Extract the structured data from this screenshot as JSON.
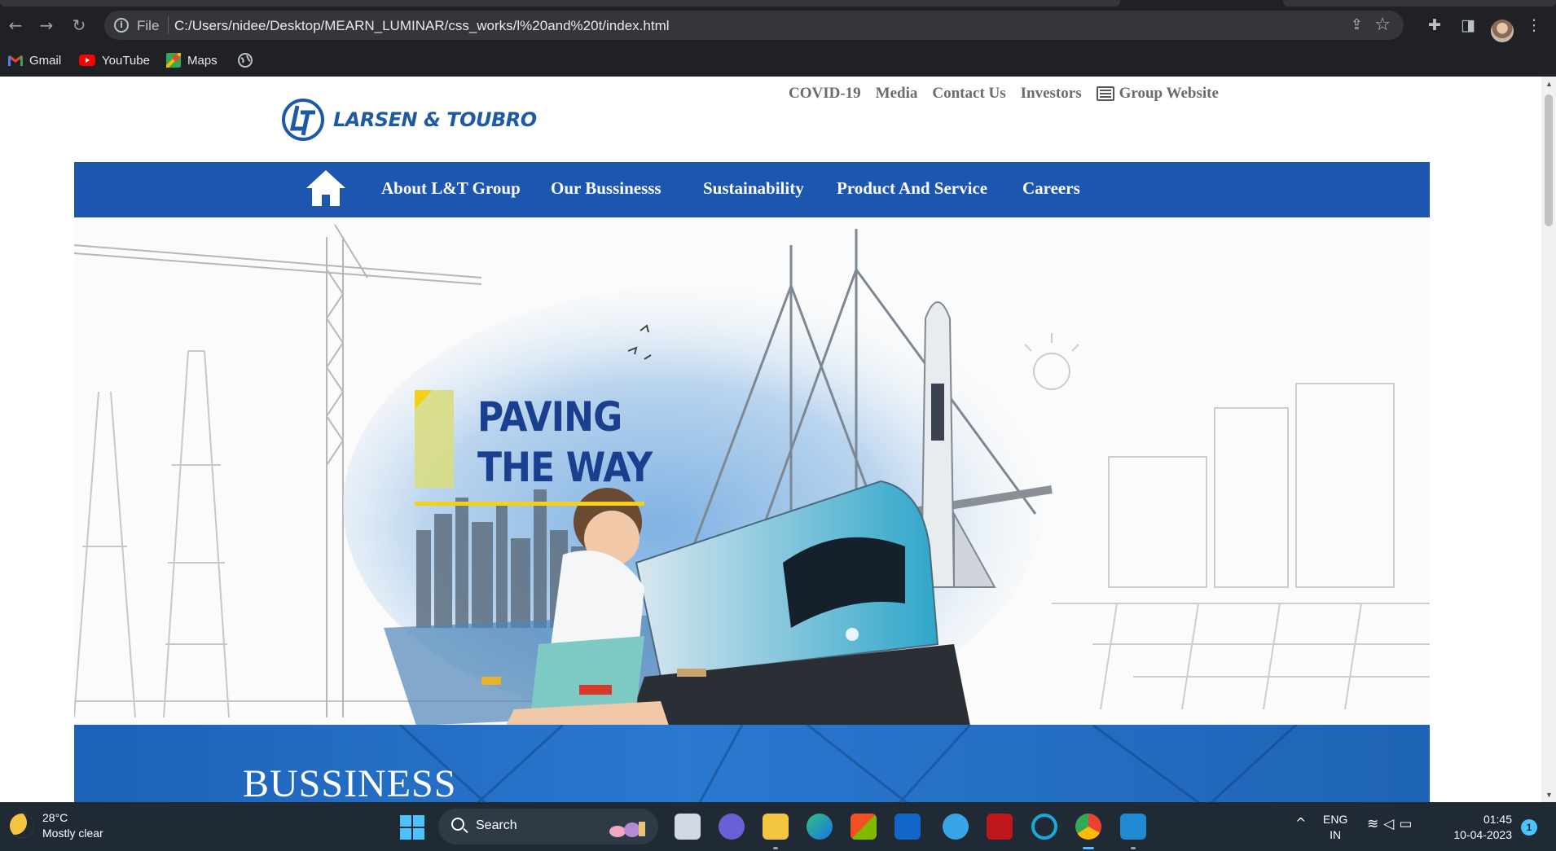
{
  "browser": {
    "url_scheme": "File",
    "url": "C:/Users/nidee/Desktop/MEARN_LUMINAR/css_works/l%20and%20t/index.html",
    "bookmarks": [
      "Gmail",
      "YouTube",
      "Maps"
    ]
  },
  "site": {
    "logo_text": "LARSEN & TOUBRO",
    "top_links": [
      "COVID-19",
      "Media",
      "Contact Us",
      "Investors",
      "Group Website"
    ],
    "nav": [
      "About L&T Group",
      "Our Bussinesss",
      "Sustainability",
      "Product And Service",
      "Careers"
    ],
    "hero_line1": "PAVING",
    "hero_line2": "THE WAY",
    "section_title": "BUSSINESS"
  },
  "taskbar": {
    "temperature": "28°C",
    "weather": "Mostly clear",
    "search_label": "Search",
    "lang_line1": "ENG",
    "lang_line2": "IN",
    "time": "01:45",
    "date": "10-04-2023",
    "notification_count": "1"
  },
  "colors": {
    "brand_blue": "#1c56ae",
    "logo_blue": "#1c5aa6",
    "hero_text": "#1b3f8f",
    "accent_yellow": "#f5d016"
  },
  "icons": [
    "back-icon",
    "forward-icon",
    "reload-icon",
    "info-icon",
    "share-icon",
    "star-icon",
    "extensions-icon",
    "sidepanel-icon",
    "menu-icon",
    "home-icon",
    "windows-start-icon",
    "search-icon"
  ]
}
